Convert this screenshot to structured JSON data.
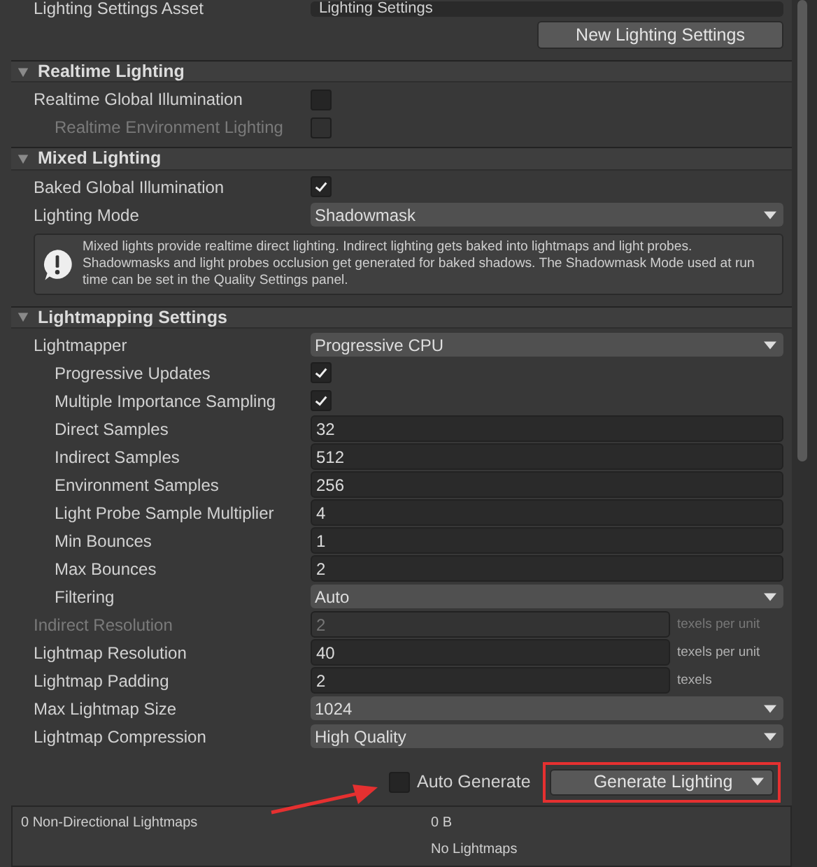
{
  "asset_row": {
    "label": "Lighting Settings Asset",
    "value": "Lighting Settings"
  },
  "new_button": {
    "label": "New Lighting Settings"
  },
  "sections": [
    {
      "title": "Realtime Lighting",
      "expanded": true,
      "rows": [
        {
          "kind": "checkbox",
          "label": "Realtime Global Illumination",
          "checked": false,
          "disabled": false,
          "children": [
            {
              "kind": "checkbox",
              "label": "Realtime Environment Lighting",
              "checked": false,
              "disabled": true
            }
          ]
        }
      ]
    },
    {
      "title": "Mixed Lighting",
      "expanded": true,
      "rows": [
        {
          "kind": "checkbox",
          "label": "Baked Global Illumination",
          "checked": true,
          "disabled": false
        },
        {
          "kind": "dropdown",
          "label": "Lighting Mode",
          "value": "Shadowmask",
          "disabled": false
        },
        {
          "kind": "info",
          "text": "Mixed lights provide realtime direct lighting. Indirect lighting gets baked into lightmaps and light probes. Shadowmasks and light probes occlusion get generated for baked shadows. The Shadowmask Mode used at run time can be set in the Quality Settings panel."
        }
      ]
    },
    {
      "title": "Lightmapping Settings",
      "expanded": true,
      "rows": [
        {
          "kind": "dropdown",
          "label": "Lightmapper",
          "value": "Progressive CPU",
          "disabled": false,
          "children": [
            {
              "kind": "checkbox",
              "label": "Progressive Updates",
              "checked": true,
              "disabled": false
            },
            {
              "kind": "checkbox",
              "label": "Multiple Importance Sampling",
              "checked": true,
              "disabled": false
            },
            {
              "kind": "number",
              "label": "Direct Samples",
              "value": "32",
              "disabled": false
            },
            {
              "kind": "number",
              "label": "Indirect Samples",
              "value": "512",
              "disabled": false
            },
            {
              "kind": "number",
              "label": "Environment Samples",
              "value": "256",
              "disabled": false
            },
            {
              "kind": "number",
              "label": "Light Probe Sample Multiplier",
              "value": "4",
              "disabled": false
            },
            {
              "kind": "number",
              "label": "Min Bounces",
              "value": "1",
              "disabled": false
            },
            {
              "kind": "number",
              "label": "Max Bounces",
              "value": "2",
              "disabled": false
            },
            {
              "kind": "dropdown",
              "label": "Filtering",
              "value": "Auto",
              "disabled": false
            }
          ]
        },
        {
          "kind": "number",
          "label": "Indirect Resolution",
          "value": "2",
          "suffix": "texels per unit",
          "disabled": true
        },
        {
          "kind": "number",
          "label": "Lightmap Resolution",
          "value": "40",
          "suffix": "texels per unit",
          "disabled": false
        },
        {
          "kind": "number",
          "label": "Lightmap Padding",
          "value": "2",
          "suffix": "texels",
          "disabled": false
        },
        {
          "kind": "dropdown",
          "label": "Max Lightmap Size",
          "value": "1024",
          "disabled": false
        },
        {
          "kind": "dropdown",
          "label": "Lightmap Compression",
          "value": "High Quality",
          "disabled": false
        }
      ]
    }
  ],
  "auto_generate": {
    "label": "Auto Generate",
    "checked": false
  },
  "generate_button": {
    "label": "Generate Lighting"
  },
  "stats": {
    "lightmaps": "0 Non-Directional Lightmaps",
    "size": "0 B",
    "status": "No Lightmaps"
  }
}
